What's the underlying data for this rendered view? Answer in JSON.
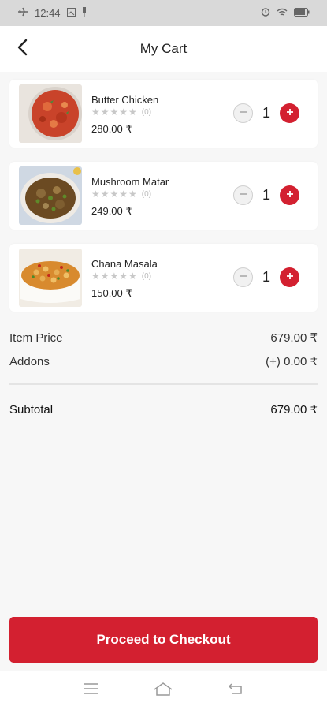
{
  "status_bar": {
    "time": "12:44"
  },
  "header": {
    "title": "My Cart"
  },
  "cart": {
    "items": [
      {
        "name": "Butter Chicken",
        "stars": "★★★★★",
        "rating_count": "(0)",
        "price": "280.00 ₹",
        "quantity": "1"
      },
      {
        "name": "Mushroom Matar",
        "stars": "★★★★★",
        "rating_count": "(0)",
        "price": "249.00 ₹",
        "quantity": "1"
      },
      {
        "name": "Chana Masala",
        "stars": "★★★★★",
        "rating_count": "(0)",
        "price": "150.00 ₹",
        "quantity": "1"
      }
    ]
  },
  "summary": {
    "item_price_label": "Item Price",
    "item_price_value": "679.00 ₹",
    "addons_label": "Addons",
    "addons_value": "(+) 0.00 ₹",
    "subtotal_label": "Subtotal",
    "subtotal_value": "679.00 ₹"
  },
  "checkout": {
    "label": "Proceed to Checkout"
  },
  "colors": {
    "accent": "#d32030",
    "background": "#f7f7f7"
  },
  "icons": {
    "back": "arrow-back-icon",
    "minus": "minus-icon",
    "plus": "plus-icon",
    "nav_menu": "menu-icon",
    "nav_home": "home-icon",
    "nav_back": "back-nav-icon"
  }
}
